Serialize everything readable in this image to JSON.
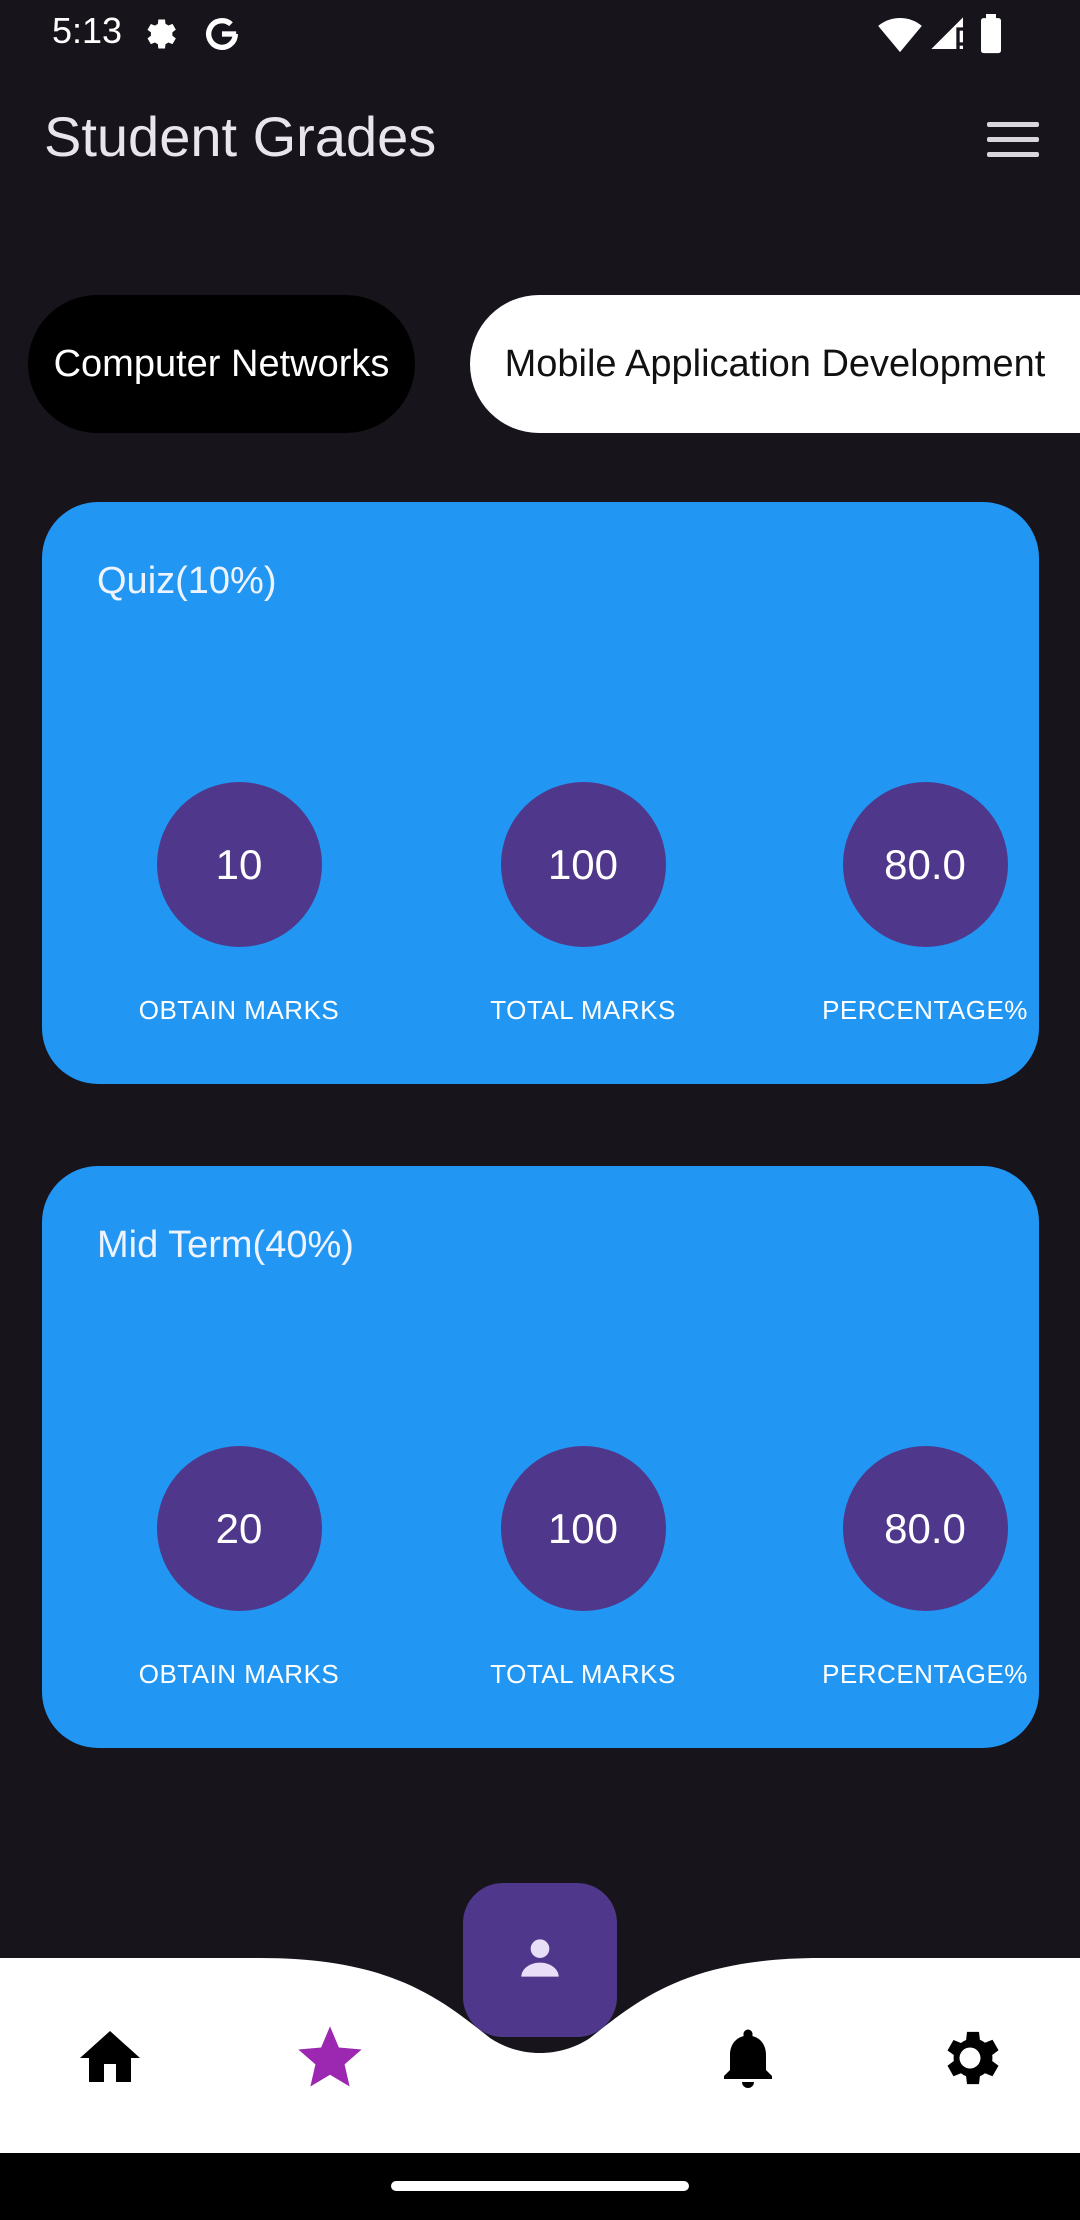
{
  "status_bar": {
    "time": "5:13",
    "icons": [
      "settings-gear-icon",
      "google-g-icon",
      "wifi-icon",
      "signal-icon",
      "battery-icon"
    ]
  },
  "app_bar": {
    "title": "Student Grades",
    "menu_icon": "hamburger-menu-icon"
  },
  "tabs": [
    {
      "label": "Computer Networks",
      "selected": true
    },
    {
      "label": "Mobile Application Development",
      "selected": false
    }
  ],
  "cards": [
    {
      "title": "Quiz(10%)",
      "stats": [
        {
          "value": "10",
          "label": "OBTAIN MARKS"
        },
        {
          "value": "100",
          "label": "TOTAL MARKS"
        },
        {
          "value": "80.0",
          "label": "PERCENTAGE%"
        }
      ]
    },
    {
      "title": "Mid Term(40%)",
      "stats": [
        {
          "value": "20",
          "label": "OBTAIN MARKS"
        },
        {
          "value": "100",
          "label": "TOTAL MARKS"
        },
        {
          "value": "80.0",
          "label": "PERCENTAGE%"
        }
      ]
    }
  ],
  "bottom_nav": {
    "items": [
      {
        "icon": "home-icon",
        "active": false
      },
      {
        "icon": "star-icon",
        "active": true
      },
      {
        "icon": "person-icon",
        "active": false,
        "center": true
      },
      {
        "icon": "bell-icon",
        "active": false
      },
      {
        "icon": "settings-icon",
        "active": false
      }
    ]
  },
  "colors": {
    "background": "#17141c",
    "card": "#2196f3",
    "circle": "#4f378b",
    "star_active": "#9c27b0",
    "nav_background": "#ffffff"
  }
}
